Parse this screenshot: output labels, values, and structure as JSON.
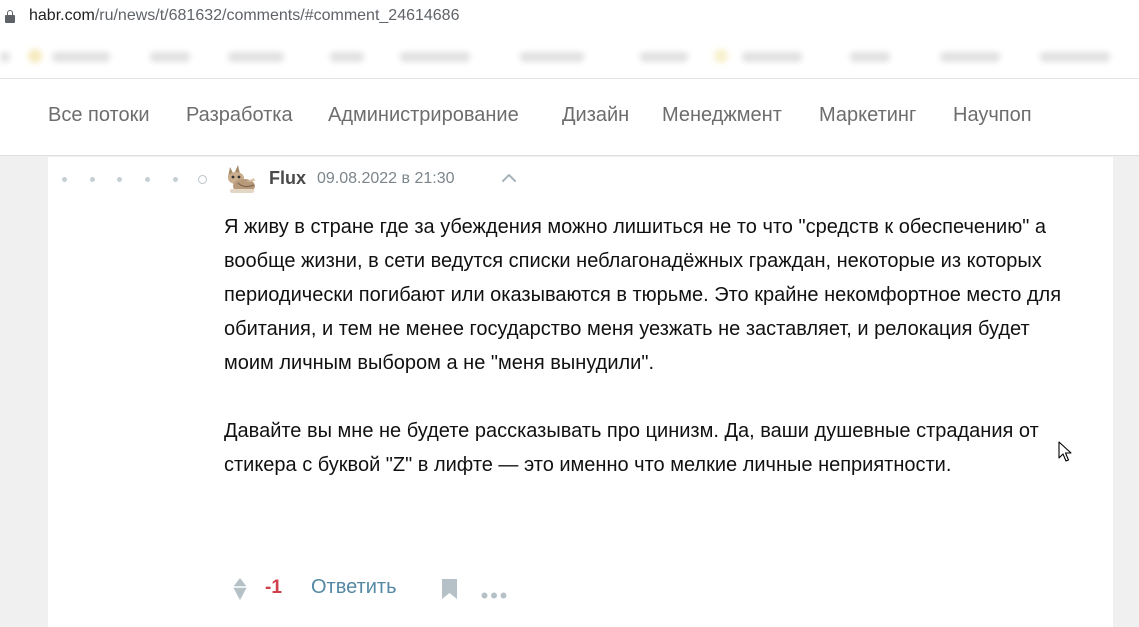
{
  "browser": {
    "url_domain": "habr.com",
    "url_path": "/ru/news/t/681632/comments/#comment_24614686",
    "lock_icon": "lock-icon"
  },
  "nav": {
    "items": [
      {
        "label": "Все потоки"
      },
      {
        "label": "Разработка"
      },
      {
        "label": "Администрирование"
      },
      {
        "label": "Дизайн"
      },
      {
        "label": "Менеджмент"
      },
      {
        "label": "Маркетинг"
      },
      {
        "label": "Научпоп"
      }
    ]
  },
  "comment": {
    "author": "Flux",
    "date": "09.08.2022 в 21:30",
    "avatar_icon": "cat-avatar-icon",
    "paragraphs": [
      "Я живу в стране где за убеждения можно лишиться не то что \"средств к обеспечению\" а вообще жизни, в сети ведутся списки неблагонадёжных граждан, некоторые из которых периодически погибают или оказываются в тюрьме. Это крайне некомфортное место для обитания, и тем не менее государство меня уезжать не заставляет, и релокация будет моим личным выбором а не \"меня вынудили\".",
      "Давайте вы мне не будете рассказывать про цинизм. Да, ваши душевные страдания от стикера с буквой \"Z\" в лифте — это именно что мелкие личные неприятности."
    ],
    "score": "-1",
    "reply_label": "Ответить",
    "icons": {
      "collapse": "chevron-up-icon",
      "vote": "vote-diamond-icon",
      "bookmark": "bookmark-icon",
      "more": "more-dots-icon"
    }
  },
  "colors": {
    "score_negative": "#d0404b",
    "reply_link": "#5488a4",
    "nav_text": "#6d6d6d",
    "icon_gray": "#b6c1c7"
  }
}
